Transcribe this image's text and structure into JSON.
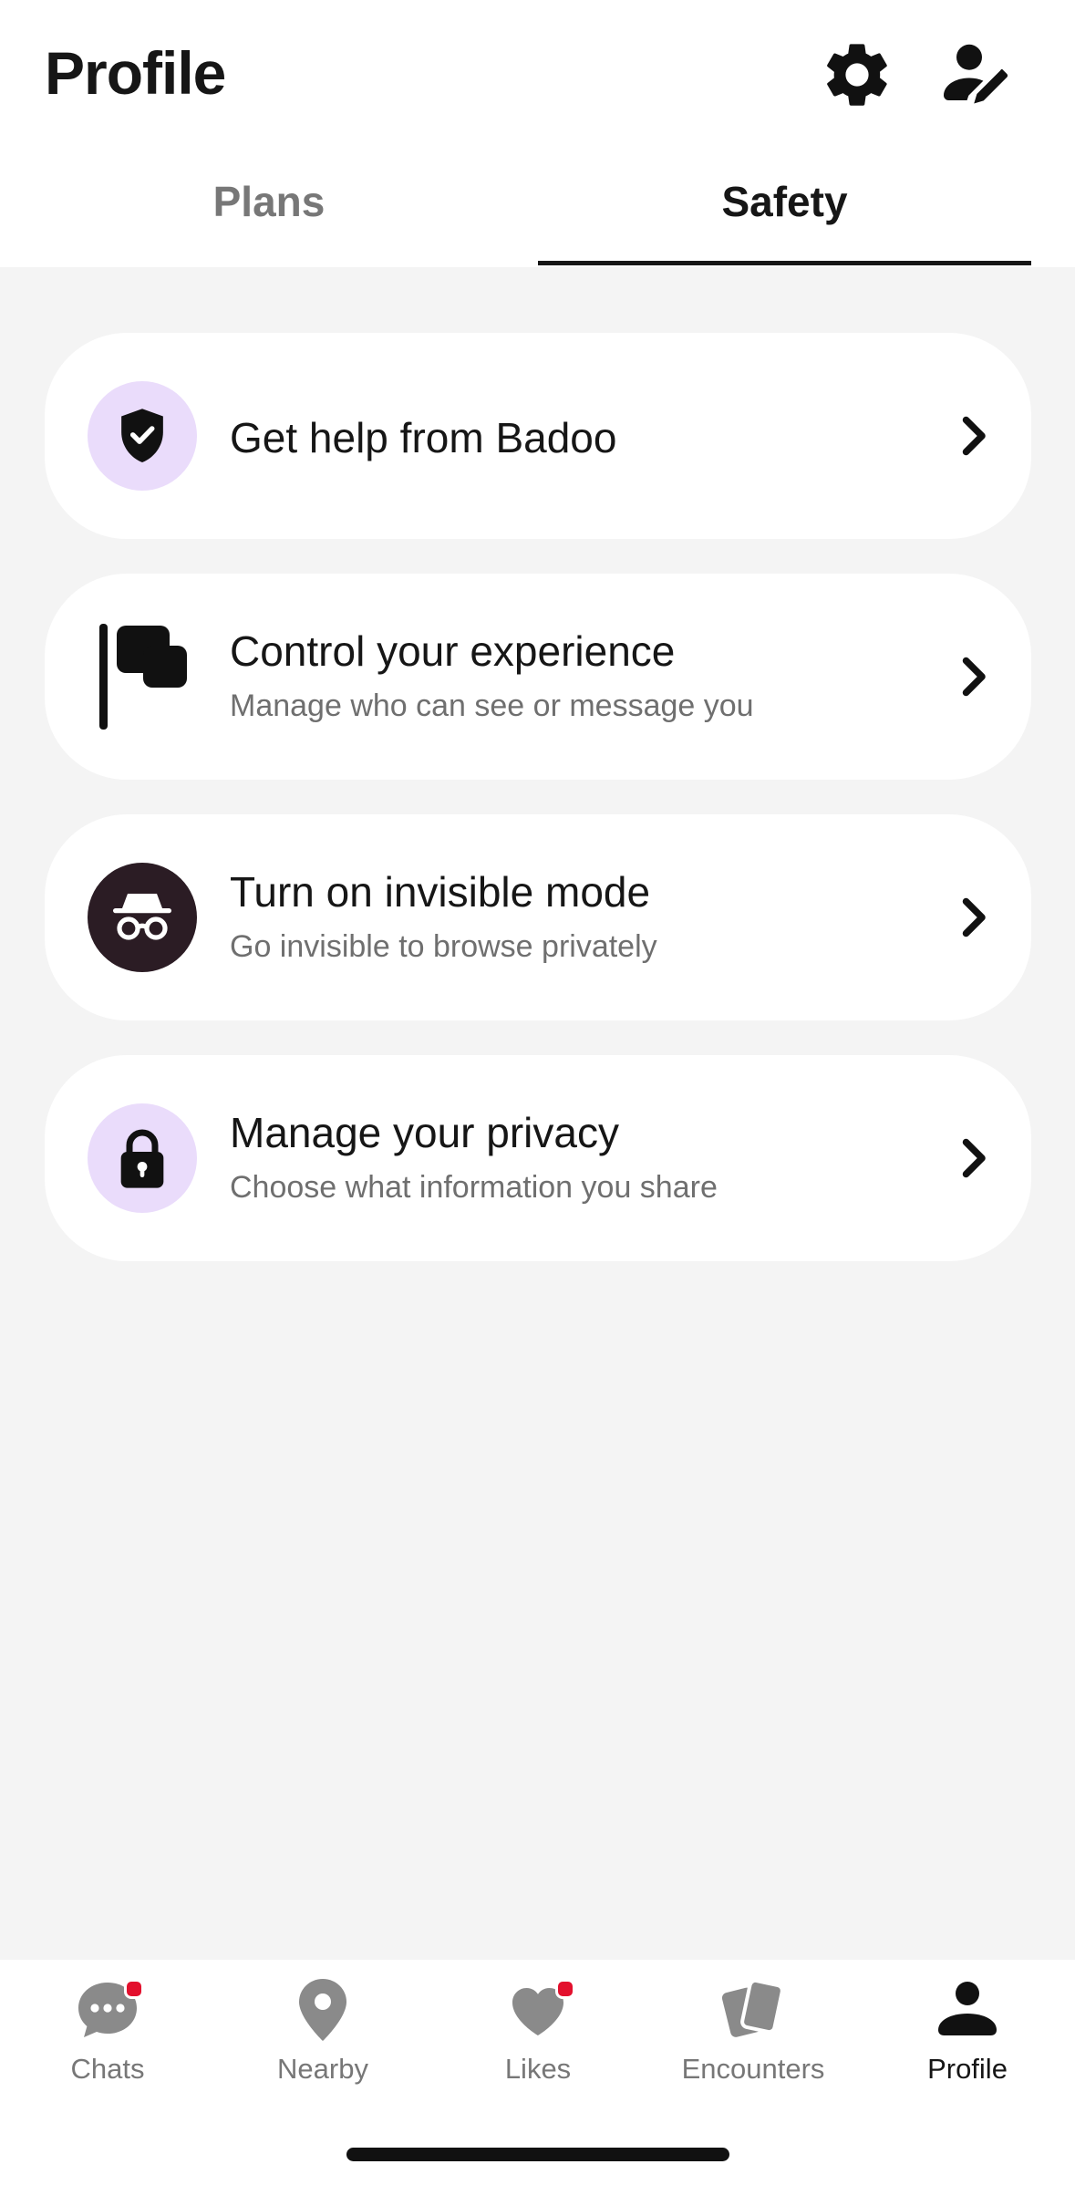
{
  "header": {
    "title": "Profile",
    "settings_icon": "gear-icon",
    "edit_profile_icon": "person-edit-icon"
  },
  "tabs": [
    {
      "label": "Plans",
      "active": false
    },
    {
      "label": "Safety",
      "active": true
    }
  ],
  "safety_items": [
    {
      "title": "Get help from Badoo",
      "subtitle": "",
      "icon": "shield-check-icon"
    },
    {
      "title": "Control your experience",
      "subtitle": "Manage who can see or message you",
      "icon": "flag-icon"
    },
    {
      "title": "Turn on invisible mode",
      "subtitle": "Go invisible to browse privately",
      "icon": "incognito-icon"
    },
    {
      "title": "Manage your privacy",
      "subtitle": "Choose what information you share",
      "icon": "lock-icon"
    }
  ],
  "bottom_nav": [
    {
      "label": "Chats",
      "icon": "chat-bubble-icon",
      "badge": true,
      "active": false
    },
    {
      "label": "Nearby",
      "icon": "location-pin-icon",
      "badge": false,
      "active": false
    },
    {
      "label": "Likes",
      "icon": "heart-icon",
      "badge": true,
      "active": false
    },
    {
      "label": "Encounters",
      "icon": "cards-icon",
      "badge": false,
      "active": false
    },
    {
      "label": "Profile",
      "icon": "person-icon",
      "badge": false,
      "active": true
    }
  ],
  "colors": {
    "accent_light": "#eadcfb",
    "dark_icon_bg": "#2b1c24",
    "badge": "#e3102d",
    "background": "#f4f4f4"
  }
}
